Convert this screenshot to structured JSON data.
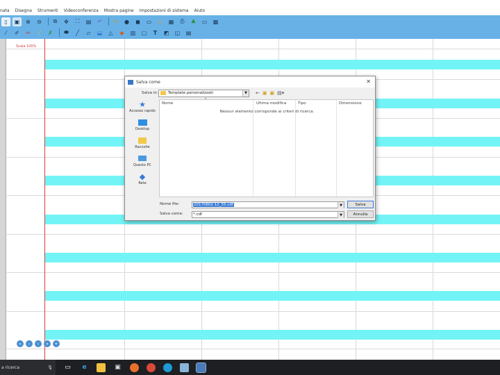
{
  "menu": [
    "nata",
    "Disegna",
    "Strumenti",
    "Videoconferenza",
    "Mostra pagine",
    "Impostazioni di sistema",
    "Aiuto"
  ],
  "toolbar1_icons": [
    "new-icon",
    "open-icon",
    "zoom-in-icon",
    "zoom-out-icon",
    "screen-capture-icon",
    "fit-icon",
    "fullscreen-icon",
    "page-icon",
    "undo-icon",
    "pen-icon",
    "record-icon",
    "camera-icon",
    "window-icon",
    "arrow-icon",
    "save-icon",
    "print-icon",
    "share-icon",
    "sticker-icon",
    "monitor-icon",
    "gallery-icon"
  ],
  "toolbar2_icons": [
    "pencil-icon",
    "marker-icon",
    "brush-icon",
    "highlighter-icon",
    "magic-pen-icon",
    "eraser-icon",
    "line-icon",
    "shape-icon",
    "fill-icon",
    "triangle-icon",
    "media-icon",
    "chart-icon",
    "text-box-icon",
    "text-icon",
    "image-icon",
    "graph-icon",
    "ruler-icon"
  ],
  "scale_label": "Scala 100%",
  "dialog": {
    "title": "Salva come",
    "save_in_label": "Salva in:",
    "save_in_value": "Template personalizzati",
    "places": [
      {
        "label": "Accesso rapido",
        "icon": "star-icon",
        "color": "#3a7bd5"
      },
      {
        "label": "Desktop",
        "icon": "desktop-icon",
        "color": "#2f8fe0"
      },
      {
        "label": "Raccolte",
        "icon": "library-icon",
        "color": "#f4c84a"
      },
      {
        "label": "Questo PC",
        "icon": "computer-icon",
        "color": "#4a9ae0"
      },
      {
        "label": "Rete",
        "icon": "network-icon",
        "color": "#3a7bd5"
      }
    ],
    "columns": {
      "name": "Nome",
      "modified": "Ultima modifica",
      "type": "Tipo",
      "size": "Dimensione"
    },
    "empty_message": "Nessun elemento corrisponde ai criteri di ricerca.",
    "filename_label": "Nome file:",
    "filename_value": "20170602 12_55.cdf",
    "savetype_label": "Salva come:",
    "savetype_value": "*.cdf",
    "save_button": "Salva",
    "cancel_button": "Annulla"
  },
  "taskbar": {
    "search_text": "a ricerca",
    "icons": [
      "microphone-icon",
      "task-view-icon",
      "edge-icon",
      "file-explorer-icon",
      "store-icon",
      "firefox-icon",
      "chrome-icon",
      "skype-icon",
      "app-icon",
      "whiteboard-icon"
    ]
  },
  "colors": {
    "toolbar": "#68b1e6",
    "band": "#72f4f6",
    "margin_line": "#e03a3a",
    "taskbar": "#1d1f22"
  }
}
